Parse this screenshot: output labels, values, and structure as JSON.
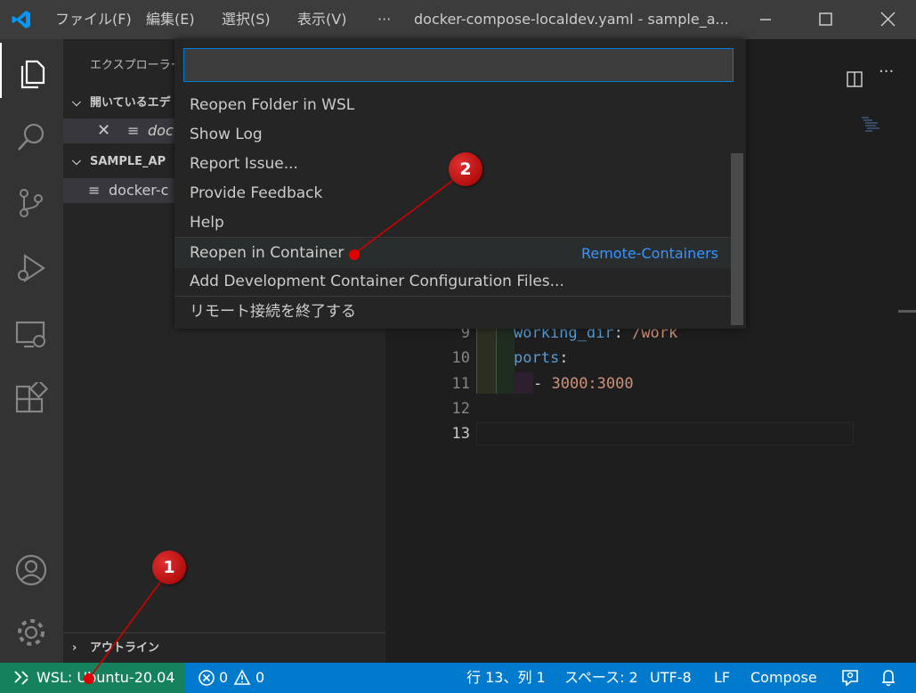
{
  "titlebar": {
    "menus": [
      "ファイル(F)",
      "編集(E)",
      "選択(S)",
      "表示(V)"
    ],
    "more": "···",
    "title": "docker-compose-localdev.yaml - sample_a..."
  },
  "sidebar": {
    "title": "エクスプローラー",
    "open_editors": "開いているエデ",
    "open_file": "doc",
    "project": "SAMPLE_AP",
    "project_file": "docker-c",
    "outline": "アウトライン"
  },
  "editor": {
    "lines": [
      {
        "num": "9",
        "key": "working_dir",
        "colon": ": ",
        "value": "/work"
      },
      {
        "num": "10",
        "key": "ports",
        "colon": ":",
        "value": ""
      },
      {
        "num": "11",
        "key": "",
        "colon": "- ",
        "value": "3000:3000"
      },
      {
        "num": "12",
        "key": "",
        "colon": "",
        "value": ""
      },
      {
        "num": "13",
        "key": "",
        "colon": "",
        "value": ""
      }
    ]
  },
  "quickpick": {
    "input_value": "",
    "items": [
      {
        "label": "Reopen Folder in WSL",
        "detail": ""
      },
      {
        "label": "Show Log",
        "detail": ""
      },
      {
        "label": "Report Issue...",
        "detail": ""
      },
      {
        "label": "Provide Feedback",
        "detail": ""
      },
      {
        "label": "Help",
        "detail": ""
      },
      {
        "label": "Reopen in Container",
        "detail": "Remote-Containers"
      },
      {
        "label": "Add Development Container Configuration Files...",
        "detail": ""
      },
      {
        "label": "リモート接続を終了する",
        "detail": ""
      }
    ]
  },
  "statusbar": {
    "remote": "WSL: Ubuntu-20.04",
    "errors": "0",
    "warnings": "0",
    "position": "行 13、列 1",
    "spaces": "スペース: 2",
    "encoding": "UTF-8",
    "eol": "LF",
    "language": "Compose"
  },
  "annotations": [
    "1",
    "2"
  ],
  "colors": {
    "accent": "#007acc",
    "remote": "#16825d",
    "highlight": "#3794ff",
    "annotation": "#c00000"
  }
}
